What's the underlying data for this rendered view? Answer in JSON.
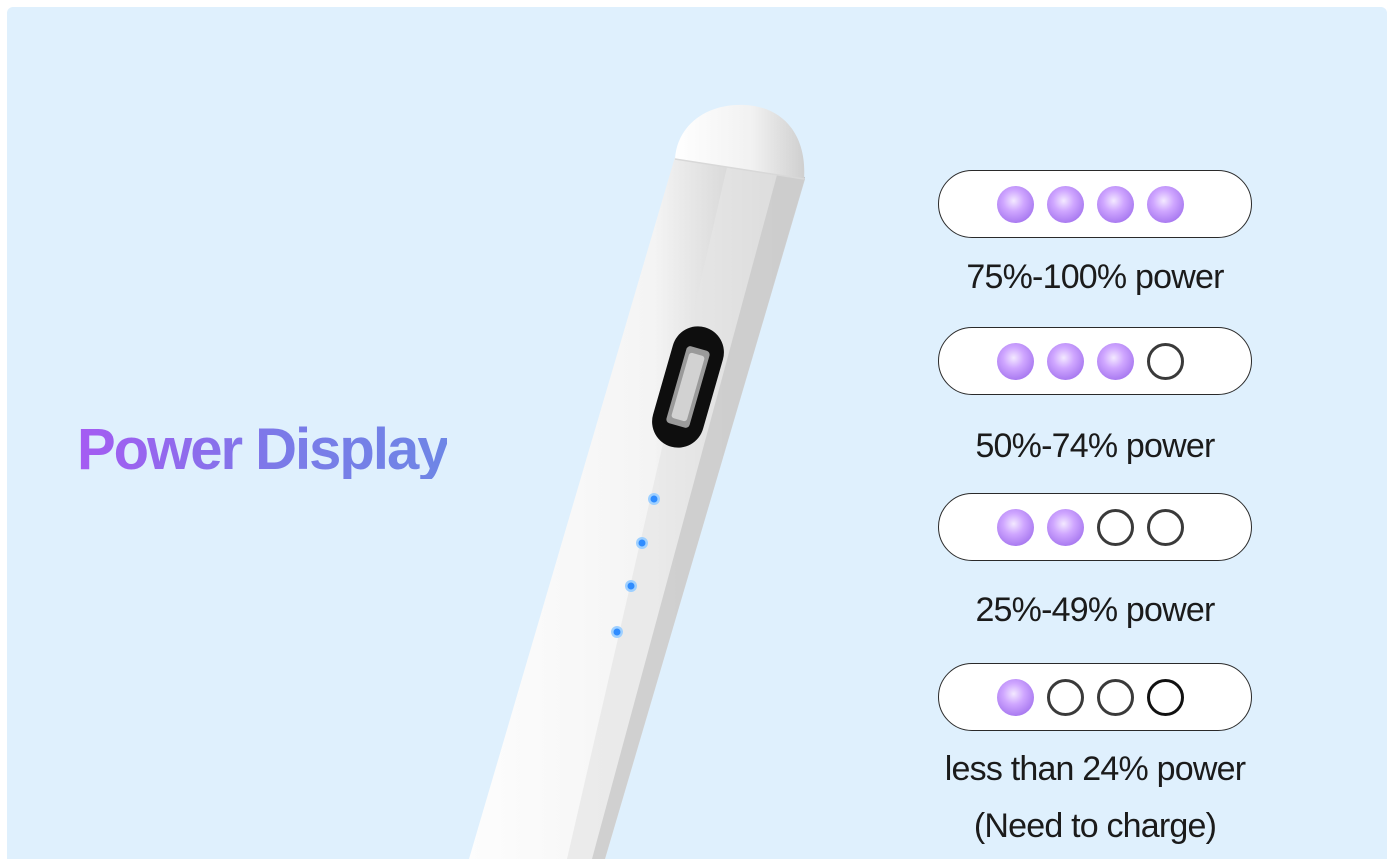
{
  "title": "Power Display",
  "levels": [
    {
      "label": "75%-100% power",
      "lit": 4,
      "total": 4
    },
    {
      "label": "50%-74% power",
      "lit": 3,
      "total": 4
    },
    {
      "label": "25%-49% power",
      "lit": 2,
      "total": 4
    },
    {
      "label": "less than 24% power",
      "lit": 1,
      "total": 4
    }
  ],
  "note": "(Need to charge)",
  "colors": {
    "background": "#dff0fd",
    "indicator_on": "#b98af5",
    "pen_led": "#2f8cff"
  }
}
